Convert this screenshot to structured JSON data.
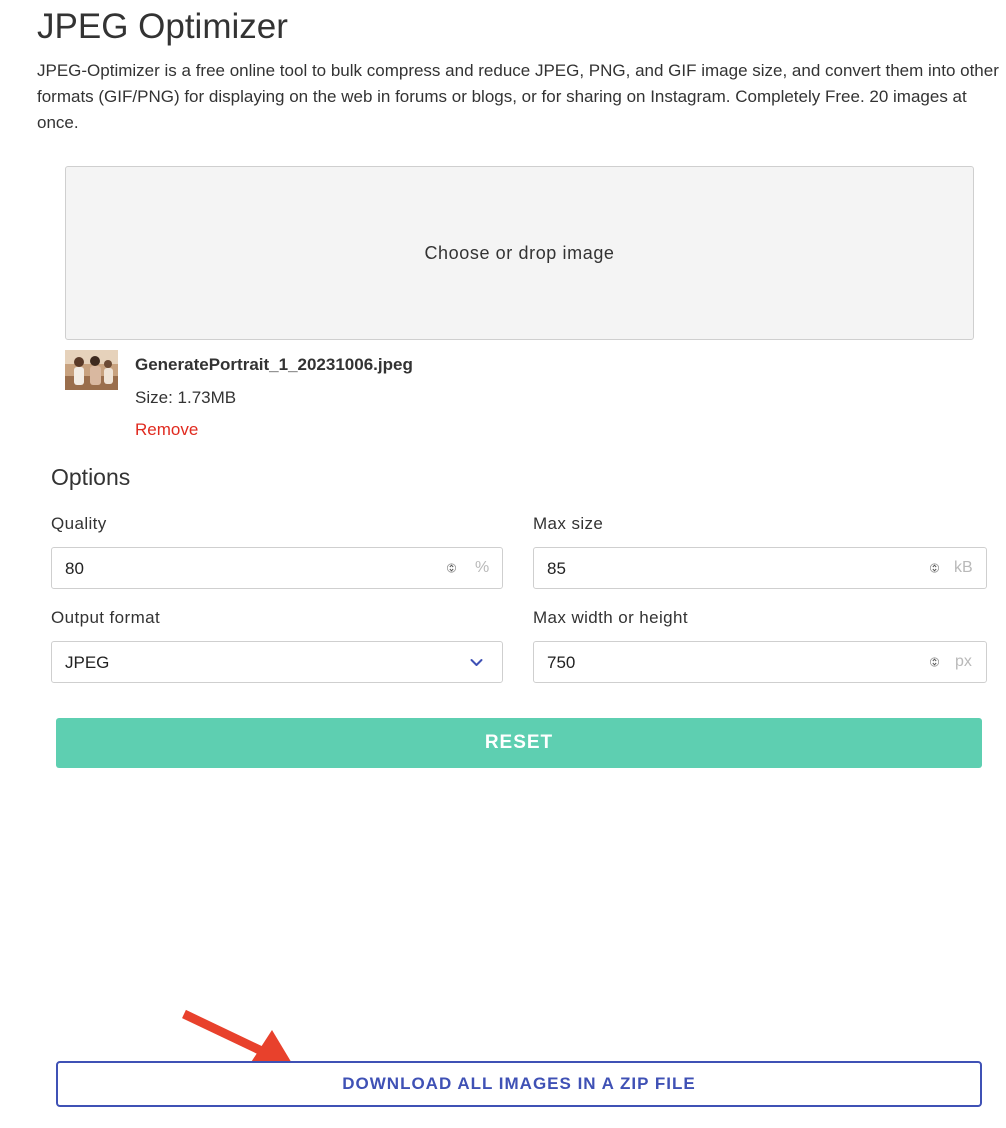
{
  "page": {
    "title": "JPEG Optimizer",
    "description": "JPEG-Optimizer is a free online tool to bulk compress and reduce JPEG, PNG, and GIF image size, and convert them into other formats (GIF/PNG) for displaying on the web in forums or blogs, or for sharing on Instagram. Completely Free. 20 images at once."
  },
  "upload": {
    "dropzone_label": "Choose or drop image",
    "file": {
      "name": "GeneratePortrait_1_20231006.jpeg",
      "size_text": "Size: 1.73MB",
      "remove_label": "Remove"
    }
  },
  "options": {
    "heading": "Options",
    "quality": {
      "label": "Quality",
      "value": "80",
      "unit": "%"
    },
    "max_size": {
      "label": "Max size",
      "value": "85",
      "unit": "kB"
    },
    "output_format": {
      "label": "Output format",
      "selected": "JPEG"
    },
    "max_dimension": {
      "label": "Max width or height",
      "value": "750",
      "unit": "px"
    }
  },
  "actions": {
    "reset_label": "RESET",
    "download_label": "DOWNLOAD ALL IMAGES IN A ZIP FILE"
  },
  "colors": {
    "accent_green": "#5ecfb1",
    "download_blue": "#3f51b5",
    "remove_red": "#e02a1f",
    "annotation_arrow": "#e8412c"
  },
  "icons": {
    "spinner": "stepper-arrows-icon",
    "select": "chevron-down-icon",
    "annotation": "red-arrow-icon"
  }
}
